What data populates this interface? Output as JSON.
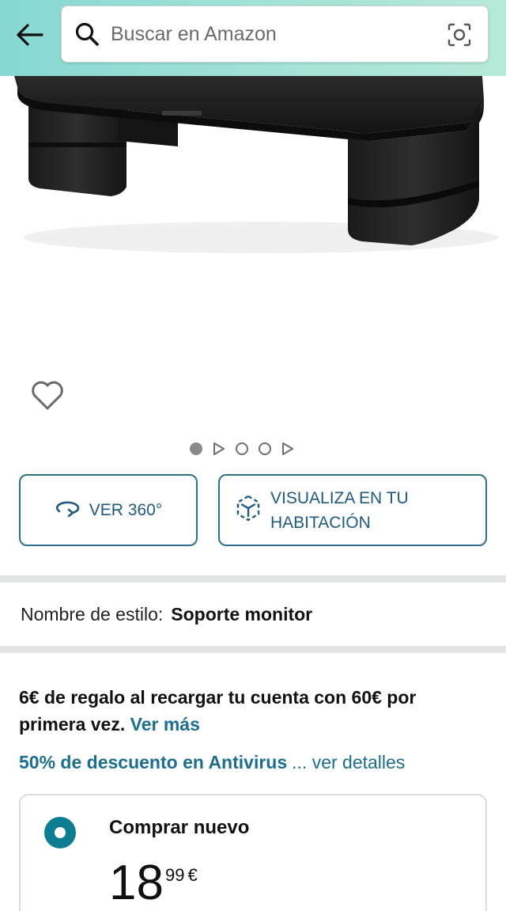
{
  "header": {
    "search_placeholder": "Buscar en Amazon",
    "background_color": "#86d8d4"
  },
  "icons": {
    "back": "back-arrow-icon",
    "search": "search-icon",
    "camera": "camera-scan-icon",
    "wishlist": "heart-icon",
    "rotate": "rotate-360-icon",
    "ar": "ar-cube-icon"
  },
  "carousel": {
    "items": [
      "image",
      "video",
      "image",
      "image",
      "video"
    ],
    "active_index": 0
  },
  "actions": {
    "view360_label": "VER 360°",
    "room_label": "VISUALIZA EN TU HABITACIÓN"
  },
  "style": {
    "label": "Nombre de estilo:",
    "value": "Soporte monitor"
  },
  "promo": {
    "text": "6€ de regalo al recargar tu cuenta con 60€ por primera vez.",
    "link": "Ver más"
  },
  "promo2": {
    "text": "50% de descuento en Antivirus",
    "link": "... ver detalles"
  },
  "buy_box": {
    "title": "Comprar nuevo",
    "price_whole": "18",
    "price_fraction": "99",
    "currency": "€",
    "accent_color": "#0d7d92"
  }
}
